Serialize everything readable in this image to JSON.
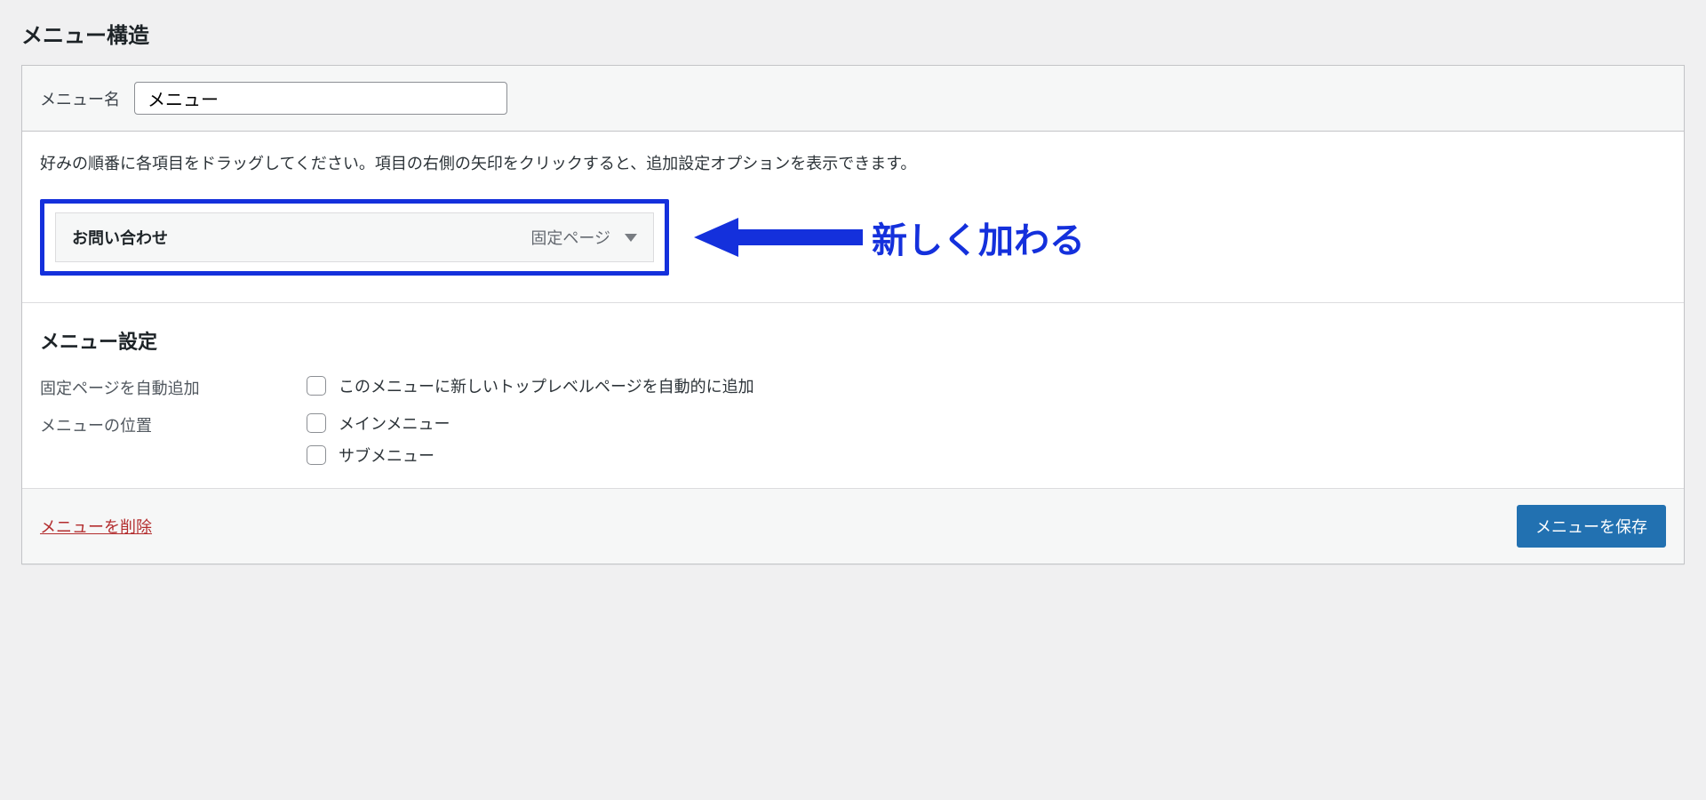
{
  "heading": "メニュー構造",
  "menu_name": {
    "label": "メニュー名",
    "value": "メニュー"
  },
  "instructions": "好みの順番に各項目をドラッグしてください。項目の右側の矢印をクリックすると、追加設定オプションを表示できます。",
  "menu_item": {
    "title": "お問い合わせ",
    "type": "固定ページ"
  },
  "annotation": "新しく加わる",
  "settings": {
    "title": "メニュー設定",
    "auto_add": {
      "label": "固定ページを自動追加",
      "option": "このメニューに新しいトップレベルページを自動的に追加"
    },
    "location": {
      "label": "メニューの位置",
      "options": [
        "メインメニュー",
        "サブメニュー"
      ]
    }
  },
  "footer": {
    "delete_label": "メニューを削除",
    "save_label": "メニューを保存"
  },
  "colors": {
    "highlight": "#1430dc",
    "primary_button": "#2271b1",
    "danger": "#b32d2e"
  }
}
